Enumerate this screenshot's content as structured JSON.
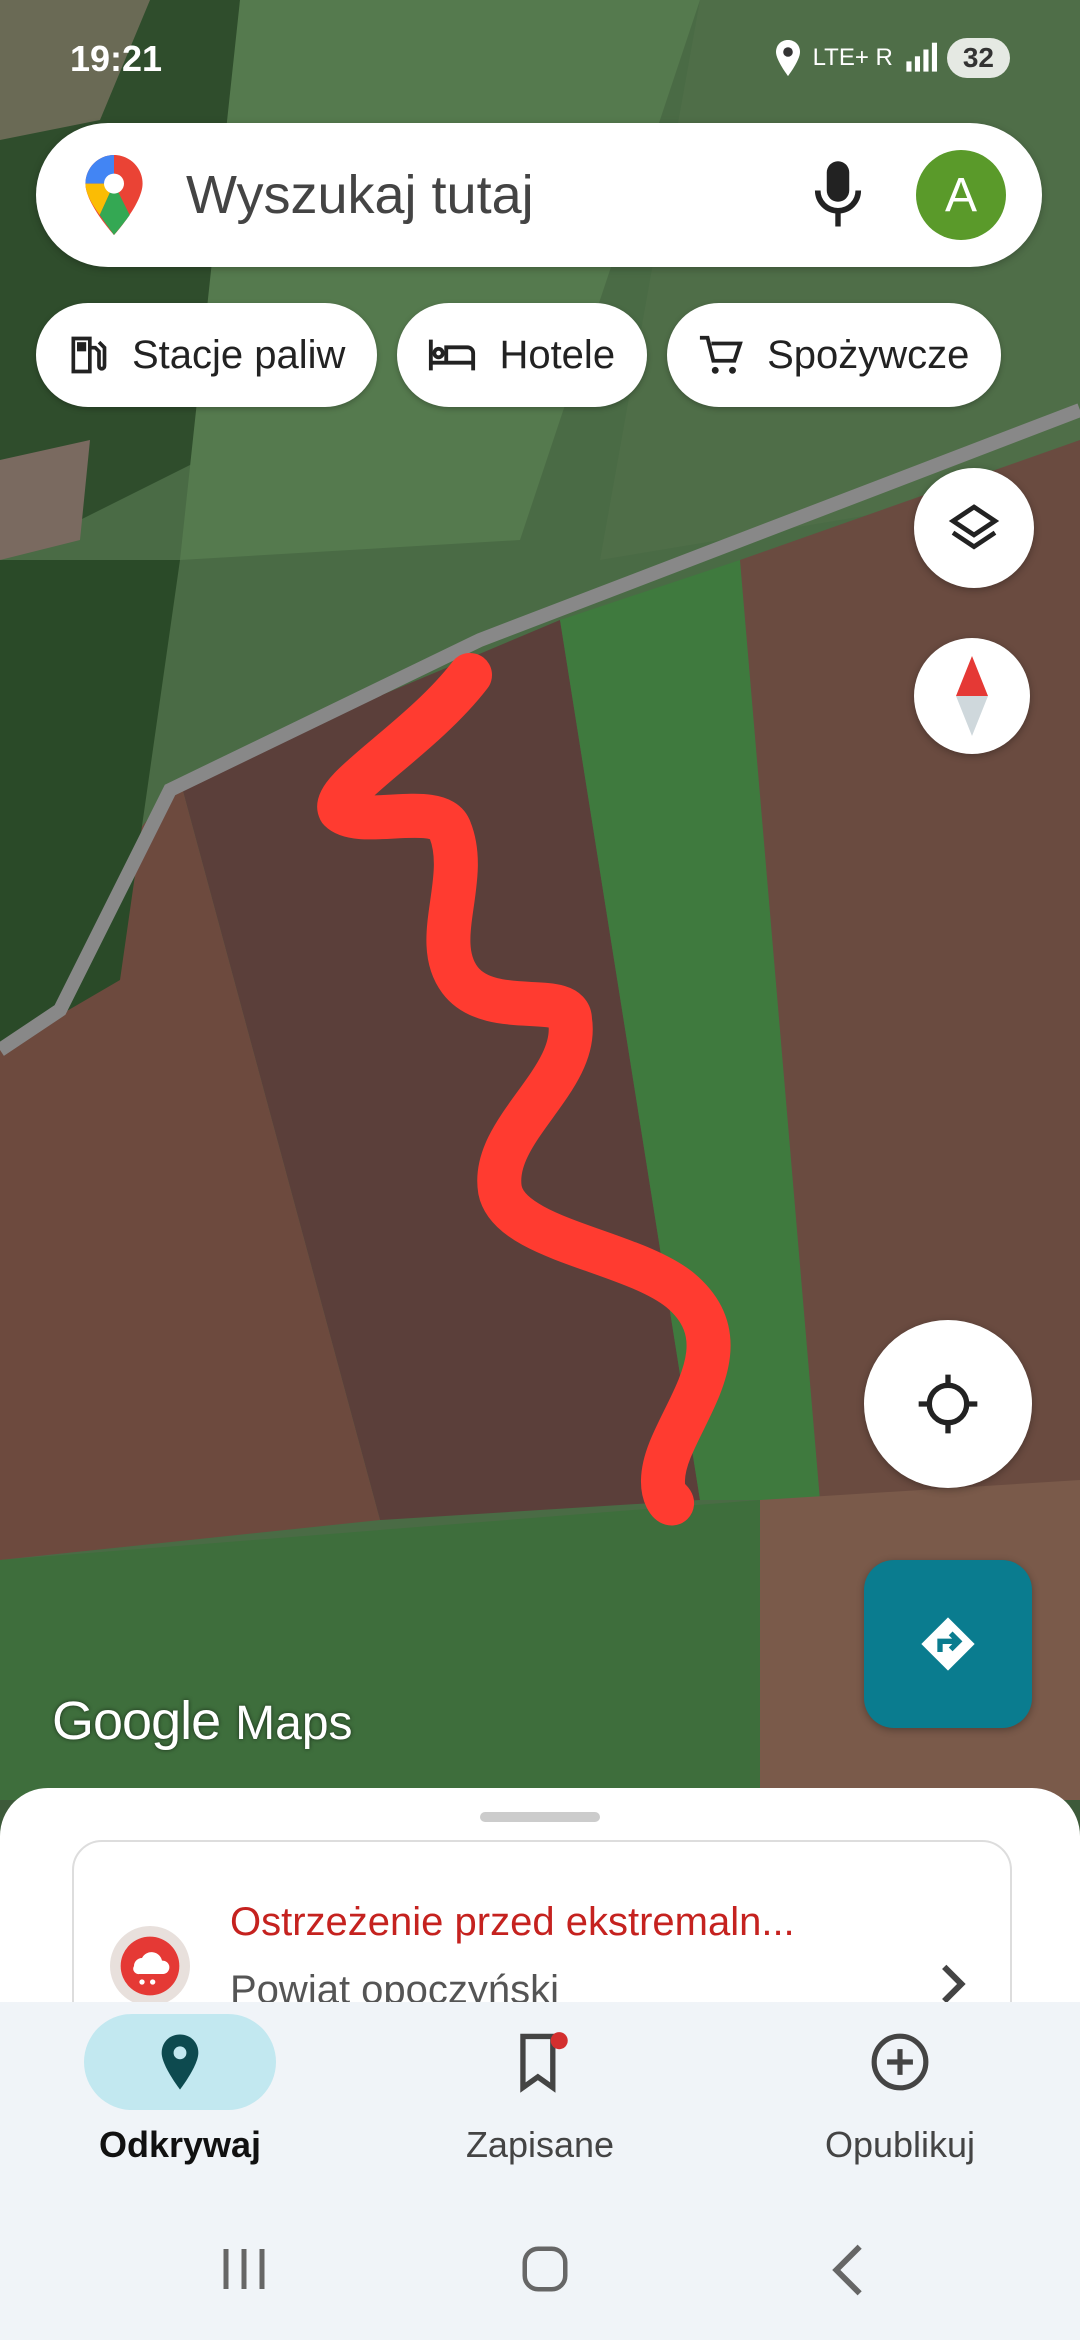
{
  "status_bar": {
    "time": "19:21",
    "network": "LTE+ R",
    "battery": "32"
  },
  "search": {
    "placeholder": "Wyszukaj tutaj",
    "avatar_letter": "A"
  },
  "chips": [
    {
      "label": "Stacje paliw",
      "icon": "gas-station-icon"
    },
    {
      "label": "Hotele",
      "icon": "hotel-bed-icon"
    },
    {
      "label": "Spożywcze",
      "icon": "shopping-cart-icon"
    }
  ],
  "map": {
    "logo_google": "Google",
    "logo_maps": "Maps",
    "route_color": "#ff3b30"
  },
  "alert": {
    "title": "Ostrzeżenie przed ekstremaln...",
    "subtitle": "Powiat opoczyński",
    "title_color": "#c5221f"
  },
  "nav": [
    {
      "label": "Odkrywaj",
      "icon": "explore-pin-icon",
      "active": true
    },
    {
      "label": "Zapisane",
      "icon": "bookmark-icon",
      "active": false
    },
    {
      "label": "Opublikuj",
      "icon": "add-circle-icon",
      "active": false
    }
  ],
  "colors": {
    "accent": "#0a7c8f",
    "avatar": "#5a9a2a"
  }
}
